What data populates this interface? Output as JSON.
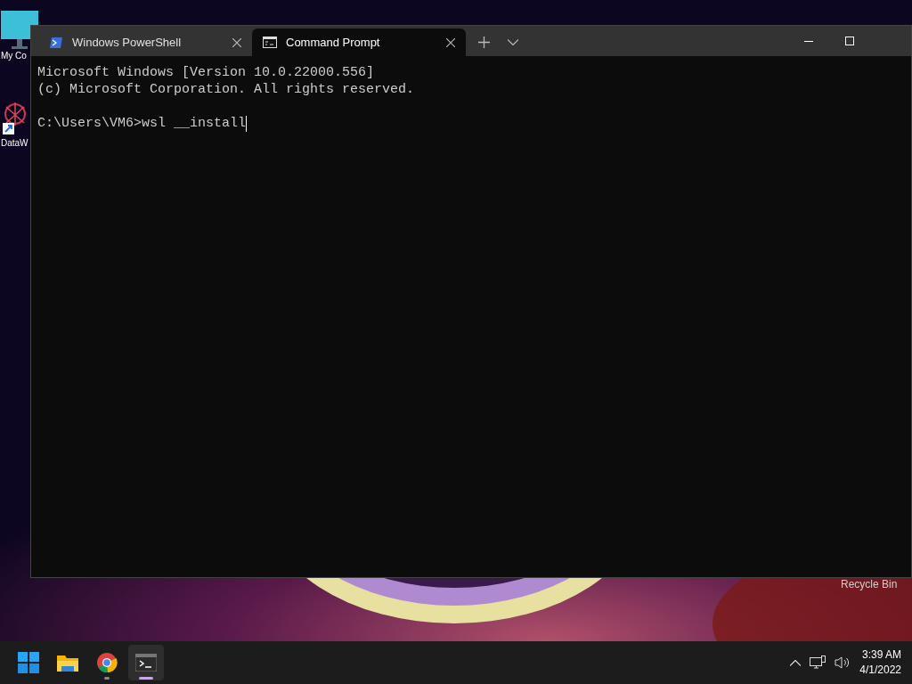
{
  "desktop": {
    "icons": [
      {
        "label": "My Co",
        "kind": "computer"
      },
      {
        "label": "DataW",
        "kind": "shortcut"
      }
    ],
    "bottom_label": "Recycle Bin"
  },
  "window": {
    "tabs": [
      {
        "title": "Windows PowerShell",
        "kind": "powershell",
        "selected": false
      },
      {
        "title": "Command Prompt",
        "kind": "cmd",
        "selected": true
      }
    ],
    "terminal": {
      "banner": [
        "Microsoft Windows [Version 10.0.22000.556]",
        "(c) Microsoft Corporation. All rights reserved."
      ],
      "prompt_line": {
        "text": "C:\\Users\\VM6>wsl __install",
        "cursor": true
      }
    }
  },
  "taskbar": {
    "apps": [
      {
        "kind": "start",
        "running": false,
        "selected": false
      },
      {
        "kind": "explorer",
        "running": false,
        "selected": false
      },
      {
        "kind": "chrome",
        "running": true,
        "selected": false
      },
      {
        "kind": "terminal",
        "running": true,
        "selected": true
      }
    ],
    "time": "3:39 AM",
    "date": "4/1/2022"
  }
}
